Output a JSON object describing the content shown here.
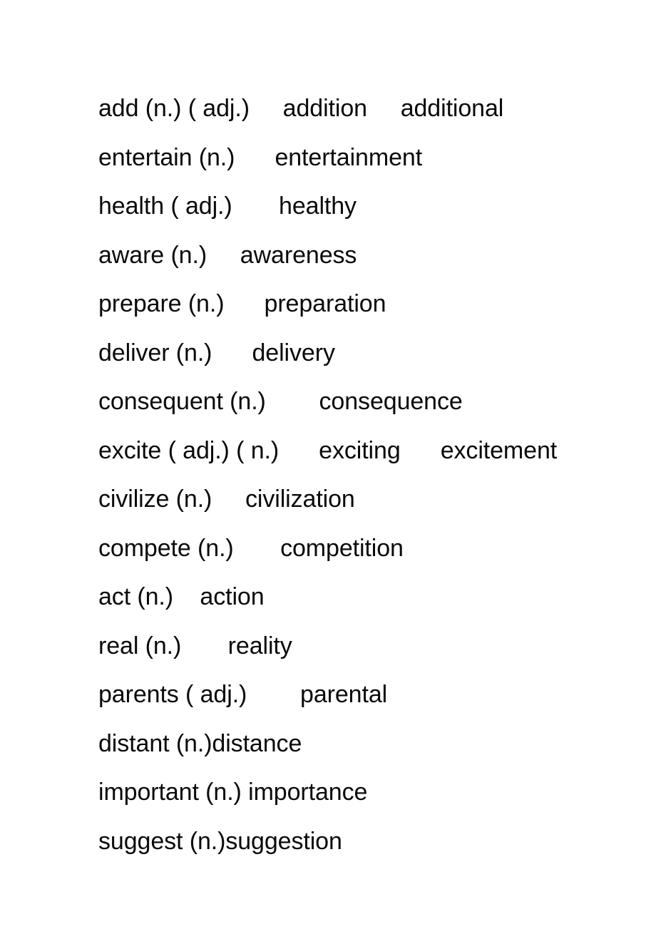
{
  "document": {
    "type": "word-formation-worksheet",
    "page_background": "#ffffff",
    "text_color": "#0a0a0a",
    "lines": [
      {
        "id": "line-1",
        "text": "add (n.) ( adj.)     addition     additional",
        "base_word": "add",
        "pos_markers": [
          "(n.)",
          "( adj.)"
        ],
        "derived_forms": [
          "addition",
          "additional"
        ]
      },
      {
        "id": "line-2",
        "text": "entertain (n.)      entertainment",
        "base_word": "entertain",
        "pos_markers": [
          "(n.)"
        ],
        "derived_forms": [
          "entertainment"
        ]
      },
      {
        "id": "line-3",
        "text": "health ( adj.)       healthy",
        "base_word": "health",
        "pos_markers": [
          "( adj.)"
        ],
        "derived_forms": [
          "healthy"
        ]
      },
      {
        "id": "line-4",
        "text": "aware (n.)     awareness",
        "base_word": "aware",
        "pos_markers": [
          "(n.)"
        ],
        "derived_forms": [
          "awareness"
        ]
      },
      {
        "id": "line-5",
        "text": "prepare (n.)      preparation",
        "base_word": "prepare",
        "pos_markers": [
          "(n.)"
        ],
        "derived_forms": [
          "preparation"
        ]
      },
      {
        "id": "line-6",
        "text": "deliver (n.)      delivery",
        "base_word": "deliver",
        "pos_markers": [
          "(n.)"
        ],
        "derived_forms": [
          "delivery"
        ]
      },
      {
        "id": "line-7",
        "text": "consequent (n.)        consequence",
        "base_word": "consequent",
        "pos_markers": [
          "(n.)"
        ],
        "derived_forms": [
          "consequence"
        ]
      },
      {
        "id": "line-8",
        "text": "excite ( adj.) ( n.)      exciting      excitement",
        "base_word": "excite",
        "pos_markers": [
          "( adj.)",
          "( n.)"
        ],
        "derived_forms": [
          "exciting",
          "excitement"
        ]
      },
      {
        "id": "line-9",
        "text": "civilize (n.)     civilization",
        "base_word": "civilize",
        "pos_markers": [
          "(n.)"
        ],
        "derived_forms": [
          "civilization"
        ]
      },
      {
        "id": "line-10",
        "text": "compete (n.)       competition",
        "base_word": "compete",
        "pos_markers": [
          "(n.)"
        ],
        "derived_forms": [
          "competition"
        ]
      },
      {
        "id": "line-11",
        "text": "act (n.)    action",
        "base_word": "act",
        "pos_markers": [
          "(n.)"
        ],
        "derived_forms": [
          "action"
        ]
      },
      {
        "id": "line-12",
        "text": "real (n.)       reality",
        "base_word": "real",
        "pos_markers": [
          "(n.)"
        ],
        "derived_forms": [
          "reality"
        ]
      },
      {
        "id": "line-13",
        "text": "parents ( adj.)        parental",
        "base_word": "parents",
        "pos_markers": [
          "( adj.)"
        ],
        "derived_forms": [
          "parental"
        ]
      },
      {
        "id": "line-14",
        "text": "distant (n.)distance",
        "base_word": "distant",
        "pos_markers": [
          "(n.)"
        ],
        "derived_forms": [
          "distance"
        ]
      },
      {
        "id": "line-15",
        "text": "important (n.) importance",
        "base_word": "important",
        "pos_markers": [
          "(n.)"
        ],
        "derived_forms": [
          "importance"
        ]
      },
      {
        "id": "line-16",
        "text": "suggest (n.)suggestion",
        "base_word": "suggest",
        "pos_markers": [
          "(n.)"
        ],
        "derived_forms": [
          "suggestion"
        ]
      }
    ]
  }
}
